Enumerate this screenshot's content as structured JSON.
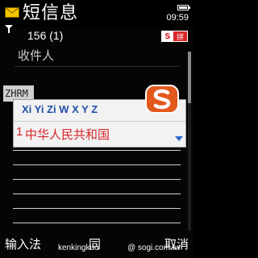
{
  "status": {
    "title": "短信息",
    "time": "09:59"
  },
  "header": {
    "counter": "156 (1)",
    "ime_badge_s": "S",
    "ime_badge_mode": "拼"
  },
  "recipient": {
    "label": "收件人"
  },
  "ime": {
    "composition": "ZHRM",
    "pinyin_candidates": "Xi Yi Zi W X Y Z",
    "candidate_index": "1",
    "candidate_text": "中华人民共和国"
  },
  "softkeys": {
    "left": "输入法",
    "middle": "同",
    "right": "取消"
  },
  "watermark": {
    "left": "kenkingkuo",
    "right": "@ sogi.com.tw"
  },
  "colors": {
    "accent_red": "#d8262b",
    "pinyin_blue": "#1f4fa6"
  }
}
